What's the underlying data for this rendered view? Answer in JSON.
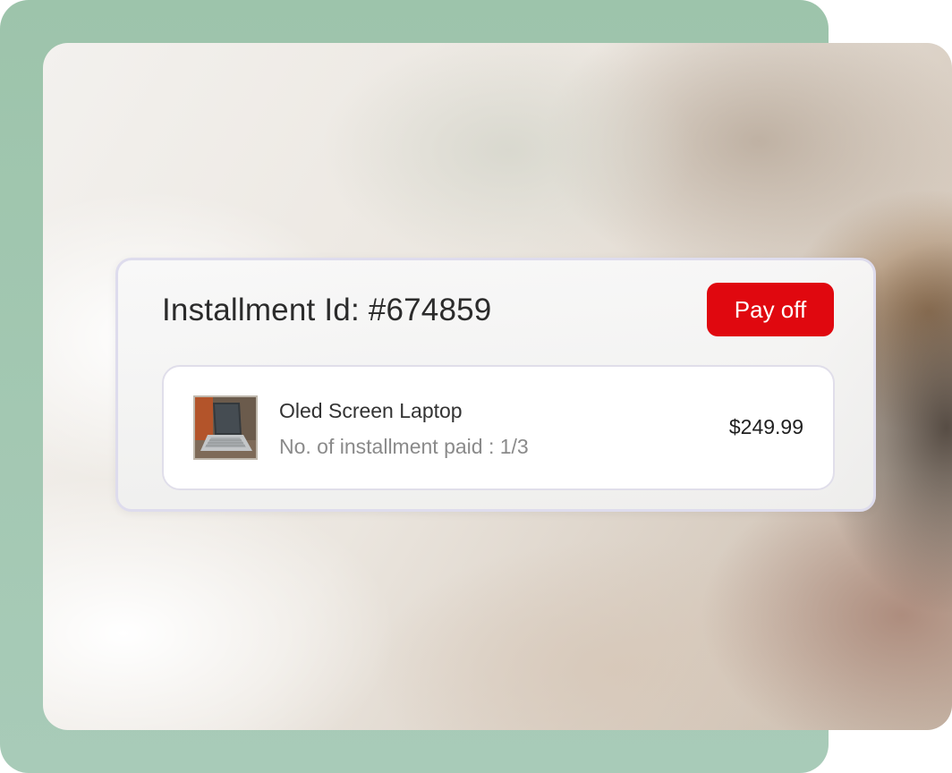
{
  "installment": {
    "title": "Installment Id: #674859",
    "action_label": "Pay off",
    "accent_color": "#e0080f"
  },
  "item": {
    "image_icon": "laptop-thumbnail",
    "name": "Oled Screen Laptop",
    "installments_paid": "No. of installment paid : 1/3",
    "price": "$249.99"
  }
}
